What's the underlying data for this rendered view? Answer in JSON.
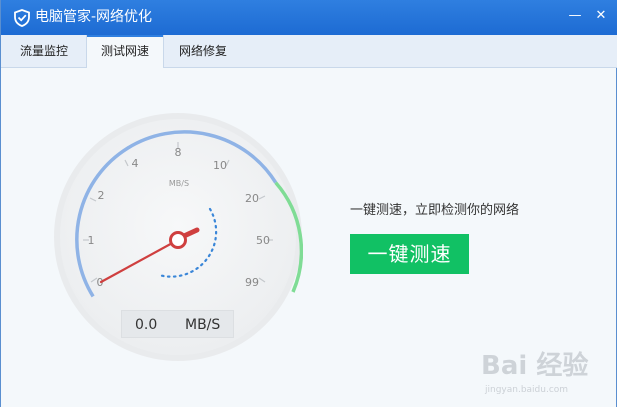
{
  "window": {
    "title": "电脑管家-网络优化",
    "controls": {
      "minimize": "—",
      "close": "✕"
    }
  },
  "tabs": [
    {
      "label": "流量监控",
      "active": false
    },
    {
      "label": "测试网速",
      "active": true
    },
    {
      "label": "网络修复",
      "active": false
    }
  ],
  "gauge": {
    "unit_label": "MB/S",
    "ticks": [
      "0",
      "1",
      "2",
      "4",
      "8",
      "10",
      "20",
      "50",
      "99"
    ],
    "current_speed": "0.0",
    "speed_unit": "MB/S"
  },
  "speedtest": {
    "hint": "一键测速，立即检测你的网络",
    "button_label": "一键测速"
  },
  "watermark": {
    "text": "Bai 经验",
    "url": "jingyan.baidu.com"
  },
  "colors": {
    "titlebar": "#1d6bd3",
    "arc_blue": "#8fb3e6",
    "arc_green": "#7fdc95",
    "needle": "#d23a3a",
    "button_green": "#11c164"
  }
}
